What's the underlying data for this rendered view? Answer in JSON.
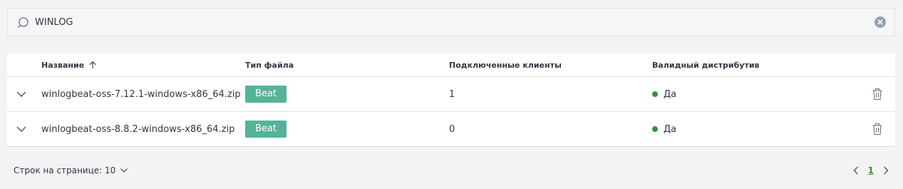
{
  "search": {
    "value": "WINLOG",
    "placeholder": ""
  },
  "table": {
    "columns": {
      "name": "Название",
      "file_type": "Тип файла",
      "clients": "Подключенные клиенты",
      "valid": "Валидный дистрибутив"
    },
    "sort": {
      "column": "name",
      "direction": "ascending"
    },
    "rows": [
      {
        "name": "winlogbeat-oss-7.12.1-windows-x86_64.zip",
        "file_type": "Beat",
        "clients": "1",
        "valid": "Да"
      },
      {
        "name": "winlogbeat-oss-8.8.2-windows-x86_64.zip",
        "file_type": "Beat",
        "clients": "0",
        "valid": "Да"
      }
    ]
  },
  "footer": {
    "rows_per_page": "Строк на странице: 10",
    "current_page": "1"
  },
  "colors": {
    "badge": "#54b399",
    "status_ok": "#3d8b3d",
    "page_link": "#3d8b3d"
  },
  "icons": {
    "search": "search-icon",
    "clear": "clear-icon",
    "sort": "arrow-up-icon",
    "expand": "chevron-down-icon",
    "delete": "trash-icon",
    "prev": "chevron-left-icon",
    "next": "chevron-right-icon"
  }
}
